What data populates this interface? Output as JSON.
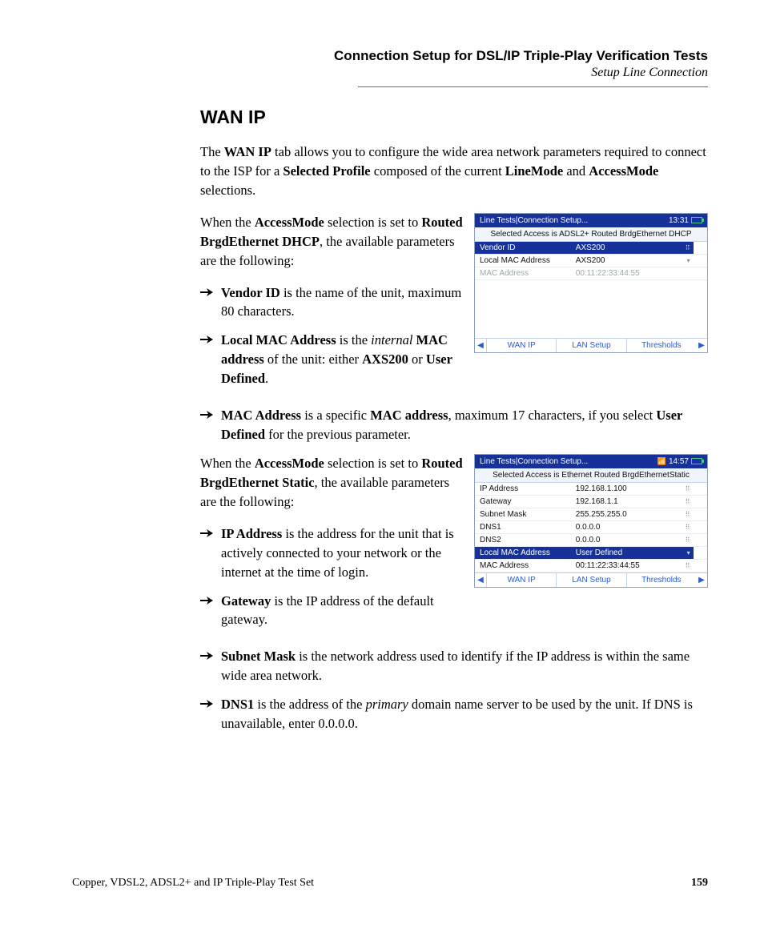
{
  "header": {
    "chapter": "Connection Setup for DSL/IP Triple-Play Verification Tests",
    "section": "Setup Line Connection"
  },
  "heading": "WAN IP",
  "intro": {
    "pre": "The ",
    "b1": "WAN IP",
    "mid1": " tab allows you to configure the wide area network parameters required to connect to the ISP for a ",
    "b2": "Selected Profile",
    "mid2": " composed of the current ",
    "b3": "LineMode",
    "mid3": " and ",
    "b4": "AccessMode",
    "post": " selections."
  },
  "block1_intro": {
    "pre": "When the ",
    "b1": "AccessMode",
    "mid1": " selection is set to ",
    "b2": "Routed BrgdEthernet DHCP",
    "post": ", the available parameters are the following:"
  },
  "block1_items": {
    "i1_b": "Vendor ID",
    "i1_t": " is the name of the unit, maximum 80 characters.",
    "i2_b": "Local MAC Address",
    "i2_m1": " is the ",
    "i2_i": "internal",
    "i2_m2": " ",
    "i2_b2": "MAC address",
    "i2_m3": " of the unit: either ",
    "i2_b3": "AXS200",
    "i2_m4": " or ",
    "i2_b4": "User Defined",
    "i2_post": ".",
    "i3_b": "MAC Address",
    "i3_m1": " is a specific ",
    "i3_b2": "MAC address",
    "i3_m2": ", maximum 17 characters, if you select ",
    "i3_b3": "User Defined",
    "i3_post": " for the previous parameter."
  },
  "block2_intro": {
    "pre": "When the ",
    "b1": "AccessMode",
    "mid1": " selection is set to ",
    "b2": "Routed BrgdEthernet Static",
    "post": ", the available parameters are the following:"
  },
  "block2_items": {
    "i1_b": "IP Address",
    "i1_t": " is the address for the unit that is actively connected to your network or the internet at the time of login.",
    "i2_b": "Gateway",
    "i2_t": " is the IP address of the default gateway.",
    "i3_b": "Subnet Mask",
    "i3_t": " is the network address used to identify if the IP address is within the same wide area network.",
    "i4_b": "DNS1",
    "i4_m1": " is the address of the ",
    "i4_i": "primary",
    "i4_m2": " domain name server to be used by the unit. If DNS is unavailable, enter 0.0.0.0."
  },
  "device1": {
    "title": "Line Tests|Connection Setup...",
    "time": "13:31",
    "sub": "Selected Access is ADSL2+ Routed BrdgEthernet DHCP",
    "rows": [
      {
        "label": "Vendor ID",
        "value": "AXS200",
        "sel": true,
        "grip": true
      },
      {
        "label": "Local MAC Address",
        "value": "AXS200",
        "caret": true
      },
      {
        "label": "MAC Address",
        "value": "00:11:22:33:44:55",
        "dim": true
      }
    ],
    "tabs": [
      "WAN IP",
      "LAN Setup",
      "Thresholds"
    ]
  },
  "device2": {
    "title": "Line Tests|Connection Setup...",
    "time": "14:57",
    "sub": "Selected Access is Ethernet Routed BrgdEthernetStatic",
    "rows": [
      {
        "label": "IP Address",
        "value": "192.168.1.100",
        "grip": true
      },
      {
        "label": "Gateway",
        "value": "192.168.1.1",
        "grip": true
      },
      {
        "label": "Subnet Mask",
        "value": "255.255.255.0",
        "grip": true
      },
      {
        "label": "DNS1",
        "value": "0.0.0.0",
        "grip": true
      },
      {
        "label": "DNS2",
        "value": "0.0.0.0",
        "grip": true
      },
      {
        "label": "Local MAC Address",
        "value": "User Defined",
        "sel": true,
        "caret": true
      },
      {
        "label": "MAC Address",
        "value": "00:11:22:33:44:55",
        "grip": true
      }
    ],
    "tabs": [
      "WAN IP",
      "LAN Setup",
      "Thresholds"
    ]
  },
  "footer": {
    "left": "Copper, VDSL2, ADSL2+ and IP Triple-Play Test Set",
    "page": "159"
  }
}
